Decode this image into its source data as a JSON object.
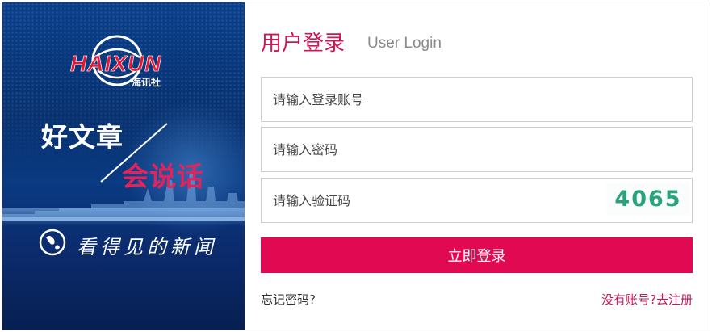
{
  "banner": {
    "logo_text": "HAIXUN",
    "logo_sub": "海讯社",
    "slogan_line1": "好文章",
    "slogan_line2": "会说话",
    "tagline": "看得见的新闻"
  },
  "login": {
    "title": "用户登录",
    "subtitle": "User Login",
    "username_placeholder": "请输入登录账号",
    "password_placeholder": "请输入密码",
    "captcha_placeholder": "请输入验证码",
    "captcha_code": "4065",
    "submit_label": "立即登录",
    "forgot_label": "忘记密码?",
    "register_prompt": "没有账号?",
    "register_link": "去注册"
  },
  "colors": {
    "accent": "#e10a52",
    "title": "#d21552",
    "banner_bg": "#08316f",
    "captcha": "#2aa37a"
  }
}
